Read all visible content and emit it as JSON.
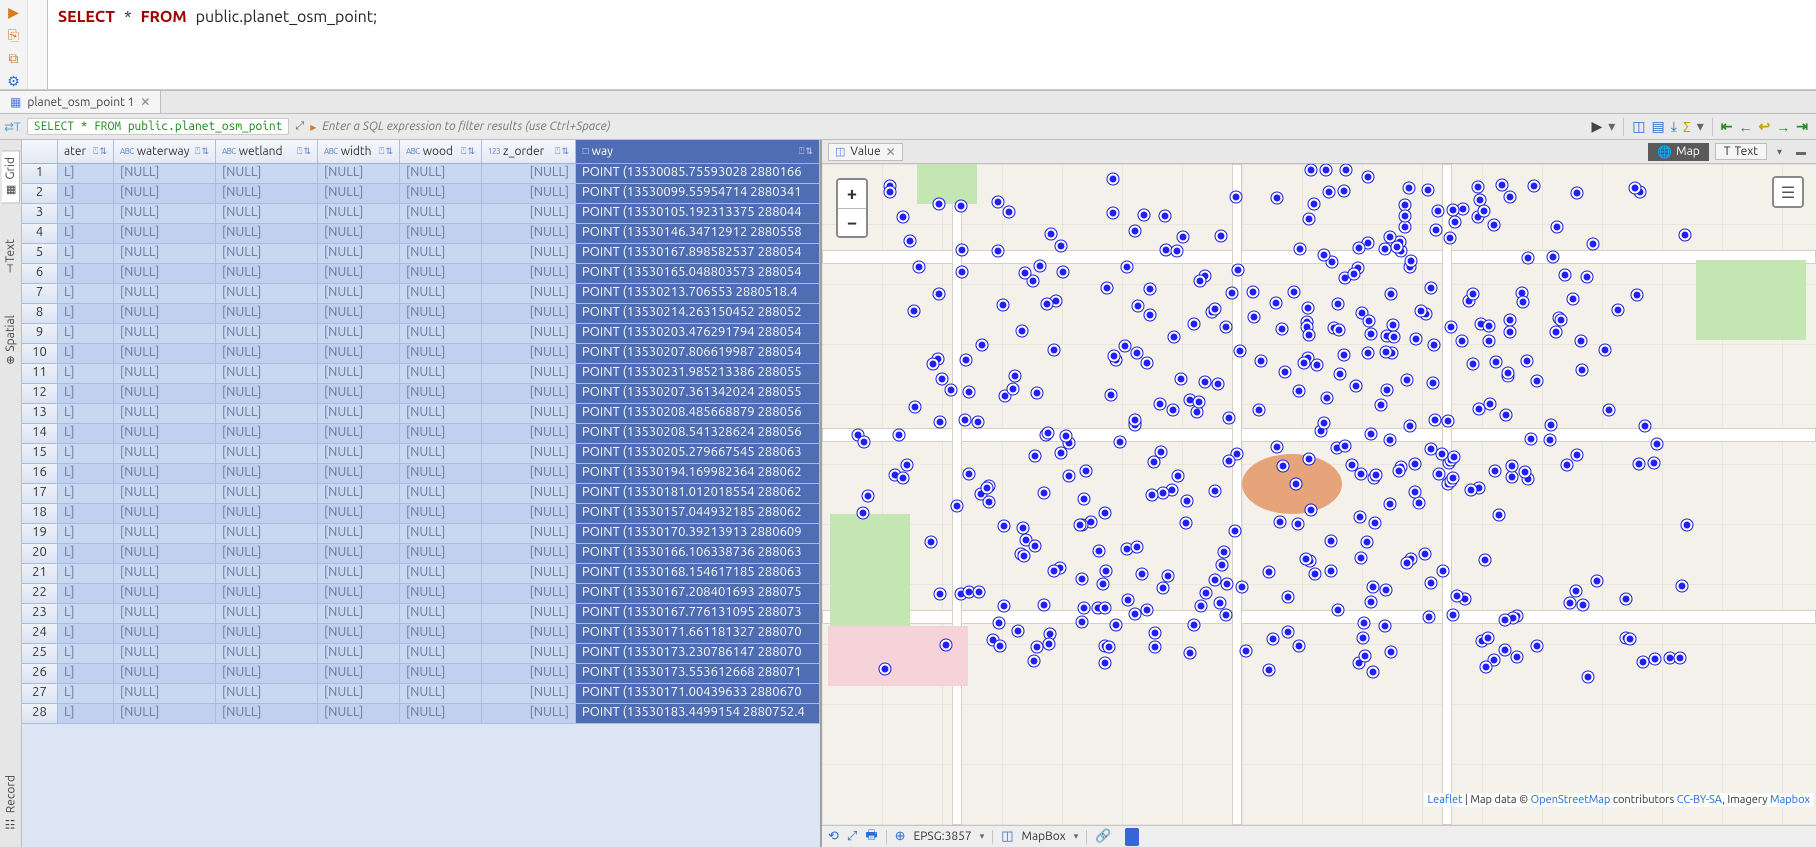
{
  "sql": {
    "keyword_select": "SELECT",
    "star": "*",
    "keyword_from": "FROM",
    "keyword_public": "public",
    "dot": ".",
    "tablename": "planet_osm_point",
    "semicolon": ";"
  },
  "tab": {
    "label": "planet_osm_point 1"
  },
  "filter": {
    "sql_text": "SELECT * FROM public.planet_osm_point",
    "placeholder": "Enter a SQL expression to filter results (use Ctrl+Space)"
  },
  "side_tabs": {
    "grid": "Grid",
    "text": "Text",
    "spatial": "Spatial",
    "record": "Record"
  },
  "columns": {
    "ater": "ater",
    "waterway": "waterway",
    "wetland": "wetland",
    "width": "width",
    "wood": "wood",
    "z_order": "z_order",
    "way": "way"
  },
  "null_text": "[NULL]",
  "lcell": "L]",
  "rows": [
    {
      "n": 1,
      "way": "POINT (13530085.75593028 2880166"
    },
    {
      "n": 2,
      "way": "POINT (13530099.55954714 2880341"
    },
    {
      "n": 3,
      "way": "POINT (13530105.192313375 288044"
    },
    {
      "n": 4,
      "way": "POINT (13530146.34712912 2880558"
    },
    {
      "n": 5,
      "way": "POINT (13530167.898582537 288054"
    },
    {
      "n": 6,
      "way": "POINT (13530165.048803573 288054"
    },
    {
      "n": 7,
      "way": "POINT (13530213.706553 2880518.4"
    },
    {
      "n": 8,
      "way": "POINT (13530214.263150452 288052"
    },
    {
      "n": 9,
      "way": "POINT (13530203.476291794 288054"
    },
    {
      "n": 10,
      "way": "POINT (13530207.806619987 288054"
    },
    {
      "n": 11,
      "way": "POINT (13530231.985213386 288055"
    },
    {
      "n": 12,
      "way": "POINT (13530207.361342024 288055"
    },
    {
      "n": 13,
      "way": "POINT (13530208.485668879 288056"
    },
    {
      "n": 14,
      "way": "POINT (13530208.541328624 288056"
    },
    {
      "n": 15,
      "way": "POINT (13530205.279667545 288063"
    },
    {
      "n": 16,
      "way": "POINT (13530194.169982364 288062"
    },
    {
      "n": 17,
      "way": "POINT (13530181.012018554 288062"
    },
    {
      "n": 18,
      "way": "POINT (13530157.044932185 288062"
    },
    {
      "n": 19,
      "way": "POINT (13530170.39213913 2880609"
    },
    {
      "n": 20,
      "way": "POINT (13530166.106338736 288063"
    },
    {
      "n": 21,
      "way": "POINT (13530168.154617185 288063"
    },
    {
      "n": 22,
      "way": "POINT (13530167.208401693 288075"
    },
    {
      "n": 23,
      "way": "POINT (13530167.776131095 288073"
    },
    {
      "n": 24,
      "way": "POINT (13530171.661181327 288070"
    },
    {
      "n": 25,
      "way": "POINT (13530173.230786147 288070"
    },
    {
      "n": 26,
      "way": "POINT (13530173.553612668 288071"
    },
    {
      "n": 27,
      "way": "POINT (13530171.00439633 2880670"
    },
    {
      "n": 28,
      "way": "POINT (13530183.4499154 2880752.4"
    }
  ],
  "value_panel": {
    "tab_label": "Value",
    "map_btn": "Map",
    "text_btn": "Text"
  },
  "map_status": {
    "srid": "EPSG:3857",
    "tiles": "MapBox"
  },
  "attrib": {
    "leaflet": "Leaflet",
    "mid": " | Map data © ",
    "osm": "OpenStreetMap",
    "contrib": " contributors ",
    "ccbysa": "CC-BY-SA",
    "imagery": ", Imagery ",
    "mapbox": "Mapbox"
  },
  "zoom": {
    "plus": "+",
    "minus": "−"
  },
  "point_count": 420
}
